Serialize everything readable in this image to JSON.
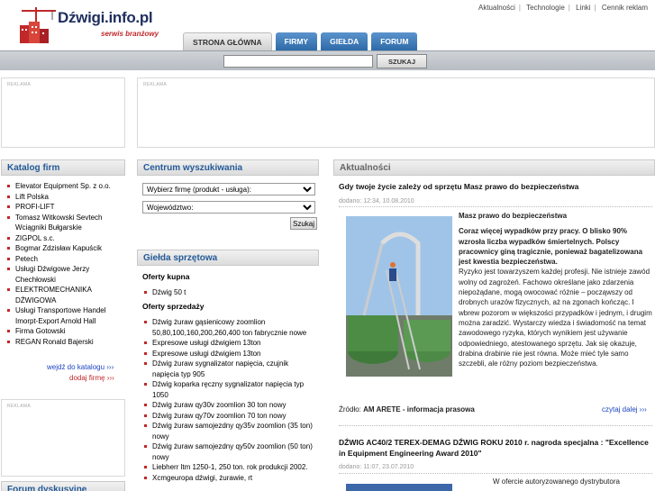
{
  "header": {
    "logo_text": "Dźwigi.info.pl",
    "logo_sub": "serwis branżowy",
    "top_links": [
      "Aktualności",
      "Technologie",
      "Linki",
      "Cennik reklam"
    ],
    "tabs": [
      "STRONA GŁÓWNA",
      "FIRMY",
      "GIEŁDA",
      "FORUM"
    ]
  },
  "search": {
    "value": "",
    "button": "SZUKAJ"
  },
  "ads": {
    "label": "REKLAMA"
  },
  "catalog": {
    "title": "Katalog firm",
    "items": [
      "Elevator Equipment Sp. z o.o.",
      "Lift Polska",
      "PROFI-LIFT",
      "Tomasz Witkowski Sevtech Wciągniki Bułgarskie",
      "ZIGPOL s.c.",
      "Bogmar Zdzisław Kapuścik",
      "Petech",
      "Usługi Dźwigowe Jerzy Chechłowski",
      "ELEKTROMECHANIKA DŹWIGOWA",
      "Usługi Transportowe Handel Imorpt-Export Arnold Hall",
      "Firma Gotowski",
      "REGAN Ronald Bajerski"
    ],
    "link_catalog": "wejdź do katalogu ›››",
    "link_add": "dodaj firmę ›››"
  },
  "forum": {
    "title": "Forum dyskusyjne"
  },
  "search_center": {
    "title": "Centrum wyszukiwania",
    "select_company": "Wybierz firmę (produkt - usługa):",
    "select_region": "Województwo:",
    "button": "Szukaj"
  },
  "exchange": {
    "title": "Giełda sprzętowa",
    "buy_title": "Oferty kupna",
    "buy_items": [
      "Dźwig 50 t"
    ],
    "sell_title": "Oferty sprzedaży",
    "sell_items": [
      "Dźwig żuraw gąsienicowy zoomlion 50,80,100,160,200,260,400 ton fabrycznie nowe",
      "Expresowe usługi dźwigiem 13ton",
      "Expresowe usługi dźwigiem 13ton",
      "Dźwig żuraw sygnalizator napięcia, czujnik napięcia typ 905",
      "Dźwig koparka ręczny sygnalizator napięcia typ 1050",
      "Dźwig żuraw qy30v zoomlion 30 ton nowy",
      "Dźwig żuraw qy70v zoomlion 70 ton nowy",
      "Dźwig żuraw samojezdny qy35v zoomlion (35 ton) nowy",
      "Dźwig żuraw samojezdny qy50v zoomlion (50 ton) nowy",
      "Liebherr ltm 1250-1, 250 ton. rok produkcji 2002.",
      "Xcmgeuropa dźwigi, żurawie, rt"
    ]
  },
  "news": {
    "title": "Aktualności",
    "article1": {
      "title": "Gdy twoje życie zależy od sprzętu Masz prawo do bezpieczeństwa",
      "meta": "dodano: 12:34, 10.08.2010",
      "heading": "Masz prawo do bezpieczeństwa",
      "lead": "Coraz więcej wypadków przy pracy. O blisko 90% wzrosła liczba wypadków śmiertelnych. Polscy pracownicy giną tragicznie, ponieważ bagatelizowana jest kwestia bezpieczeństwa.",
      "body": "Ryzyko jest towarzyszem każdej profesji. Nie istnieje zawód wolny od zagrożeń. Fachowo określane jako zdarzenia niepożądane, mogą owocować różnie – począwszy od drobnych urazów fizycznych, aż na zgonach kończąc. I wbrew pozorom w większości przypadków i jednym, i drugim można zaradzić. Wystarczy wiedza i świadomość na temat zawodowego ryzyka, których wynikiem jest używanie odpowiedniego, atestowanego sprzętu. Jak się okazuje, drabina drabinie nie jest równa. Może mieć tyle samo szczebli, ale różny poziom bezpieczeństwa.",
      "source_label": "Źródło: ",
      "source": "AM ARETE - informacja prasowa",
      "more": "czytaj dalej ›››"
    },
    "article2": {
      "title": "DŹWIG AC40/2 TEREX-DEMAG DŹWIG ROKU 2010 r. nagroda specjalna : \"Excellence in Equipment Engineering Award 2010\"",
      "meta": "dodano: 11:07, 23.07.2010",
      "body": "W ofercie autoryzowanego dystrybutora"
    }
  },
  "colors": {
    "accent_blue": "#245a97",
    "accent_red": "#c0282a"
  }
}
